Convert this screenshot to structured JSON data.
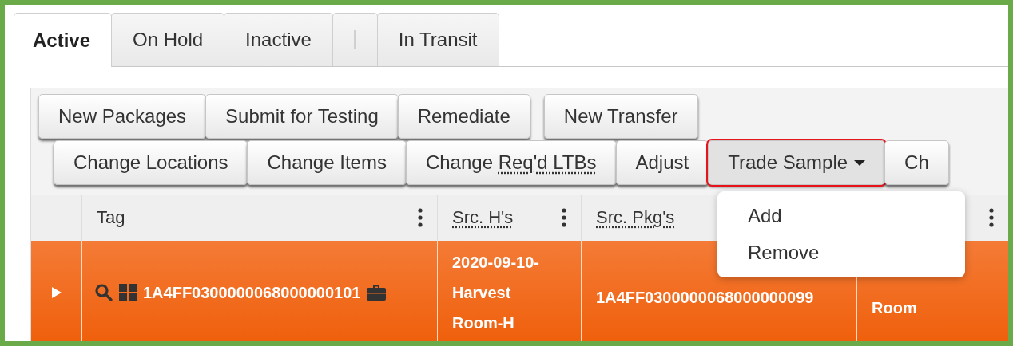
{
  "tabs": [
    {
      "kind": "tab",
      "label": "Active",
      "selected": true
    },
    {
      "kind": "tab",
      "label": "On Hold",
      "selected": false
    },
    {
      "kind": "tab",
      "label": "Inactive",
      "selected": false
    },
    {
      "kind": "separator",
      "selected": false
    },
    {
      "kind": "tab",
      "label": "In Transit",
      "selected": false
    }
  ],
  "toolbar": {
    "rows": [
      [
        {
          "label": "New Packages"
        },
        {
          "label": "Submit for Testing"
        },
        {
          "label": "Remediate"
        },
        {
          "label": "New Transfer",
          "gap_before": true
        }
      ],
      [
        {
          "label": "Change Locations"
        },
        {
          "label": "Change Items"
        },
        {
          "label": "Change",
          "abbr": "Req'd LTBs"
        },
        {
          "label": "Adjust"
        },
        {
          "label": "Trade Sample",
          "highlighted": true,
          "pressed": true,
          "caret": true
        },
        {
          "label": "Ch"
        }
      ]
    ],
    "menu": {
      "items": [
        "Add",
        "Remove"
      ]
    }
  },
  "table": {
    "columns": [
      {
        "kind": "expander"
      },
      {
        "kind": "text",
        "label": "Tag",
        "menu": true
      },
      {
        "kind": "text",
        "label": "Src. H's",
        "abbr": true,
        "menu": true
      },
      {
        "kind": "text",
        "label": "Src. Pkg's",
        "abbr": true
      },
      {
        "kind": "blank",
        "menu": true
      }
    ],
    "rows": [
      {
        "selected": true,
        "tag": "1A4FF0300000068000000101",
        "src_harvests": "2020-09-10-Harvest Room-H",
        "src_packages": "1A4FF0300000068000000099",
        "column_5": "Room"
      }
    ]
  }
}
